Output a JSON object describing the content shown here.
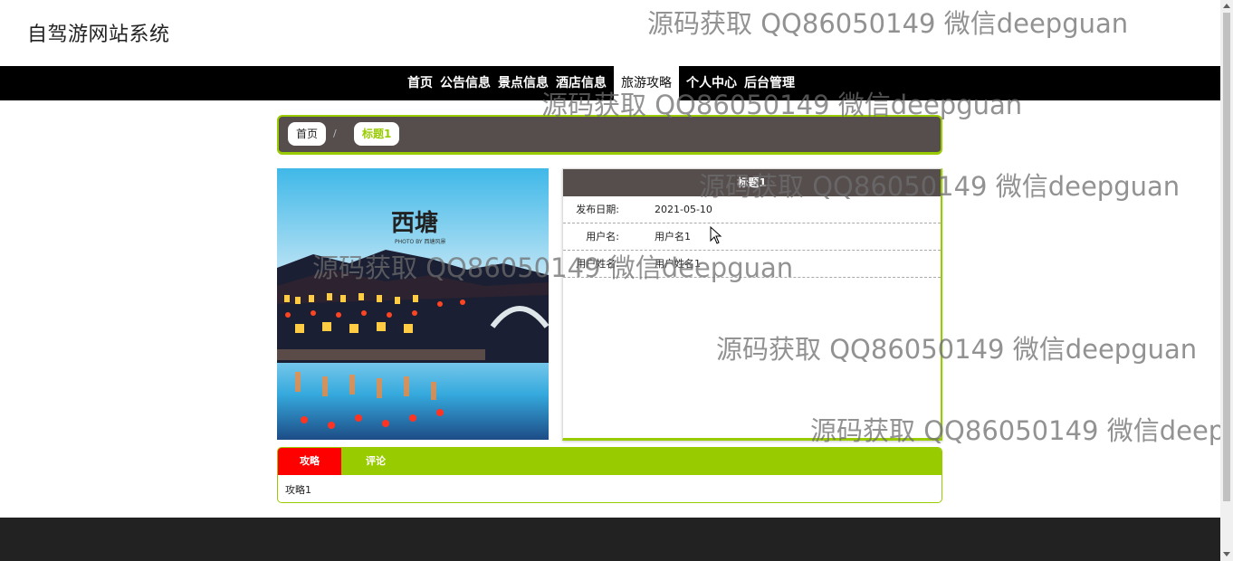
{
  "header": {
    "site_title": "自驾游网站系统"
  },
  "watermark": {
    "text": "源码获取 QQ86050149 微信deepguan"
  },
  "nav": {
    "items": [
      {
        "label": "首页"
      },
      {
        "label": "公告信息"
      },
      {
        "label": "景点信息"
      },
      {
        "label": "酒店信息"
      },
      {
        "label": "旅游攻略"
      },
      {
        "label": "个人中心"
      },
      {
        "label": "后台管理"
      }
    ],
    "active": "旅游攻略"
  },
  "breadcrumb": {
    "home": "首页",
    "separator": "/",
    "current": "标题1"
  },
  "detail": {
    "title": "标题1",
    "rows": [
      {
        "label": "发布日期:",
        "value": "2021-05-10"
      },
      {
        "label": "用户名:",
        "value": "用户名1"
      },
      {
        "label": "用户姓名:",
        "value": "用户姓名1"
      }
    ]
  },
  "photo": {
    "calligraphy": "西塘",
    "caption": "PHOTO BY 西塘风景"
  },
  "tabs": {
    "items": [
      {
        "label": "攻略"
      },
      {
        "label": "评论"
      }
    ],
    "active": "攻略",
    "content": "攻略1"
  },
  "colors": {
    "accent": "#99cc00",
    "panel": "#564d4d",
    "active_tab": "#ff0000",
    "nav": "#000000",
    "footer": "#222222"
  }
}
